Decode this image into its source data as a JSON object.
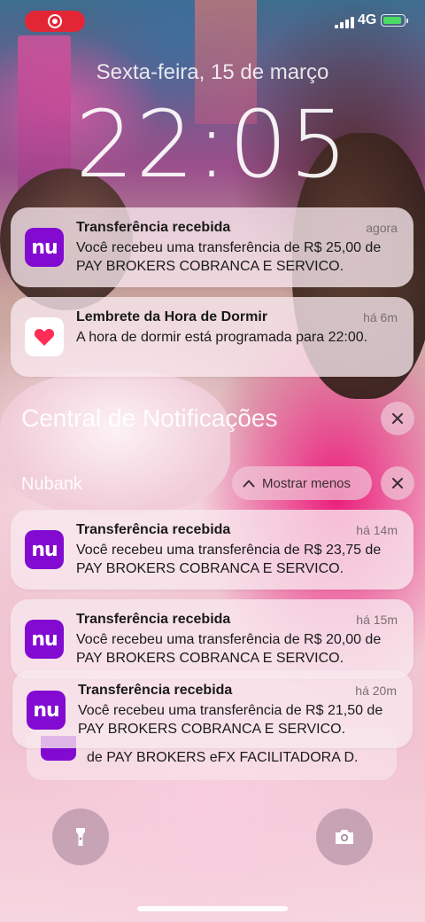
{
  "status_bar": {
    "network": "4G",
    "battery_level": 0.95,
    "accent_record": "#e32636"
  },
  "lock_screen": {
    "date": "Sexta-feira, 15 de março",
    "time": "22:05"
  },
  "notifications_top": [
    {
      "app": "Nubank",
      "icon": "nubank-icon",
      "icon_text": "nu",
      "title": "Transferência recebida",
      "time": "agora",
      "body": "Você recebeu uma transferência de R$ 25,00 de PAY BROKERS COBRANCA E SERVICO."
    },
    {
      "app": "Saúde",
      "icon": "heart-icon",
      "title": "Lembrete da Hora de Dormir",
      "time": "há 6m",
      "body": "A hora de dormir está programada para 22:00."
    }
  ],
  "notification_center": {
    "title": "Central de Notificações",
    "group": {
      "name": "Nubank",
      "show_less_label": "Mostrar menos",
      "items": [
        {
          "icon_text": "nu",
          "title": "Transferência recebida",
          "time": "há 14m",
          "body": "Você recebeu uma transferência de R$ 23,75 de PAY BROKERS COBRANCA E SERVICO."
        },
        {
          "icon_text": "nu",
          "title": "Transferência recebida",
          "time": "há 15m",
          "body": "Você recebeu uma transferência de R$ 20,00 de PAY BROKERS COBRANCA E SERVICO."
        },
        {
          "icon_text": "nu",
          "title": "Transferência recebida",
          "time": "há 20m",
          "body": "Você recebeu uma transferência de R$ 21,50 de PAY BROKERS COBRANCA E SERVICO."
        }
      ],
      "stacked_preview": "de PAY BROKERS eFX FACILITADORA D."
    }
  },
  "quick_actions": {
    "left": "flashlight-icon",
    "right": "camera-icon"
  },
  "colors": {
    "nubank_purple": "#820ad1",
    "health_red": "#ff2d55"
  }
}
